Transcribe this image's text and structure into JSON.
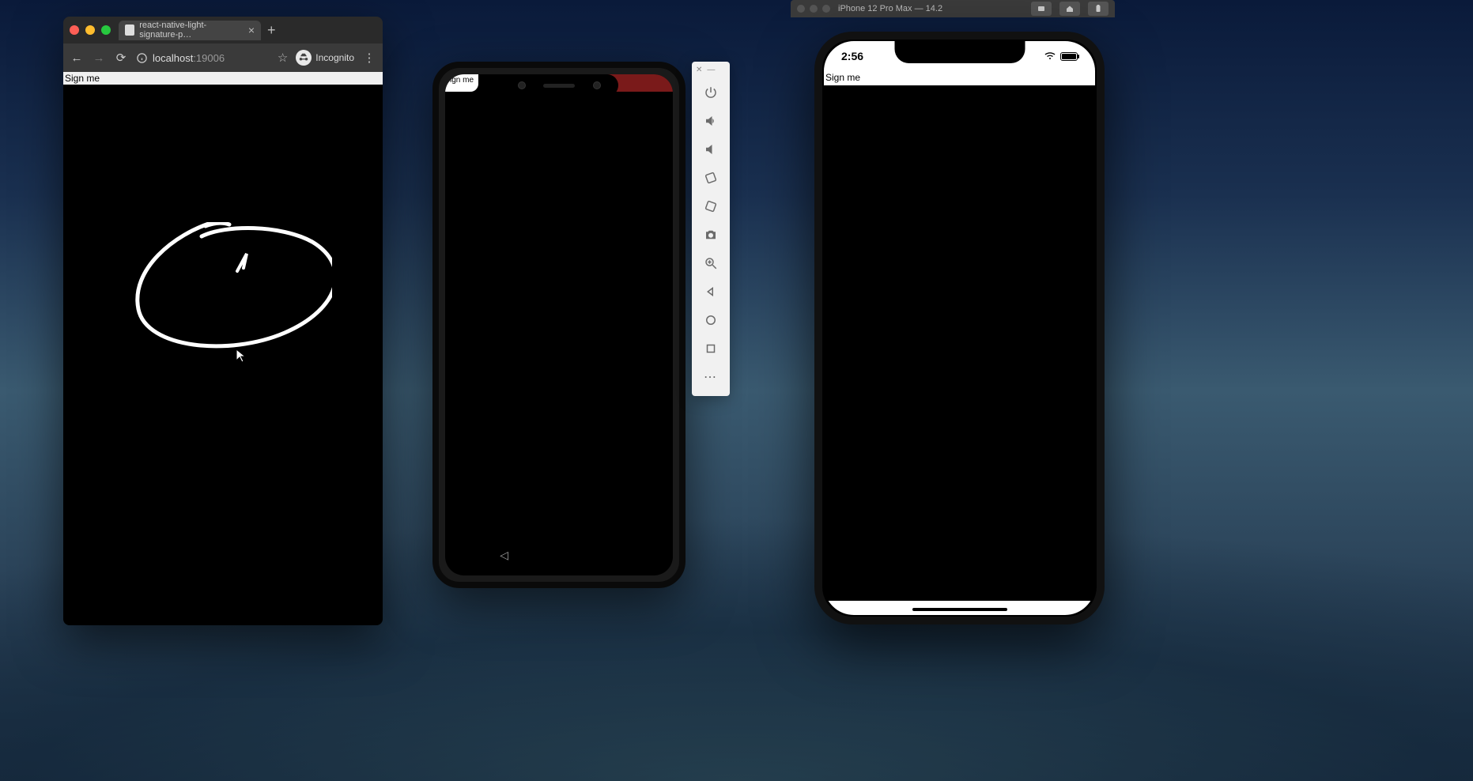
{
  "browser": {
    "tab_title": "react-native-light-signature-p…",
    "url_host": "localhost",
    "url_port": ":19006",
    "incognito_label": "Incognito",
    "sign_label": "Sign me"
  },
  "android": {
    "sign_label": "ign me",
    "emu_icons": [
      "power",
      "volume-up",
      "volume-down",
      "rotate-left",
      "rotate-right",
      "camera",
      "zoom",
      "back",
      "home",
      "overview",
      "more"
    ]
  },
  "ios": {
    "titlebar": "iPhone 12 Pro Max — 14.2",
    "clock": "2:56",
    "sign_label": "Sign me"
  }
}
